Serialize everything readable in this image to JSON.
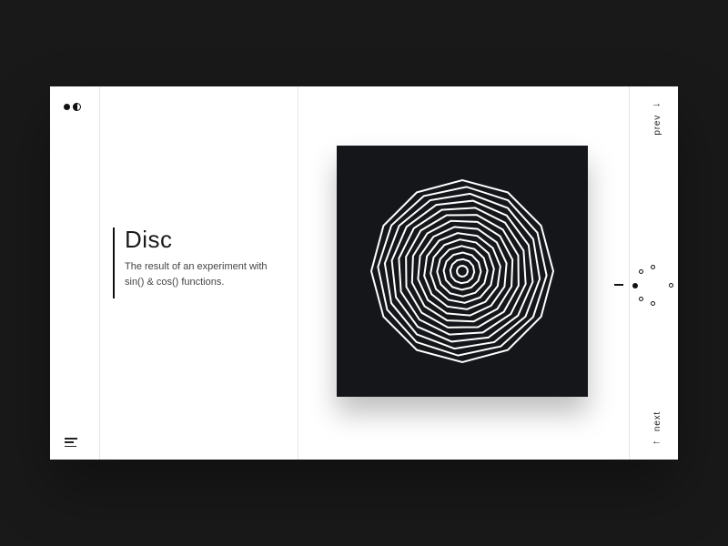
{
  "title": "Disc",
  "description": "The result of an experiment with sin() & cos() functions.",
  "nav": {
    "prev_label": "prev",
    "next_label": "next"
  },
  "cluster": {
    "count": 6,
    "active_index": 0,
    "radius": 20,
    "dots": [
      {
        "angle": 180,
        "filled": true
      },
      {
        "angle": 130,
        "filled": false
      },
      {
        "angle": 230,
        "filled": false
      },
      {
        "angle": 90,
        "filled": false
      },
      {
        "angle": 270,
        "filled": false
      },
      {
        "angle": 0,
        "filled": false
      }
    ]
  },
  "artwork": {
    "name": "disc",
    "rings": 14,
    "polygon_sides": 12,
    "stroke": "#ffffff",
    "background": "#14161a"
  }
}
